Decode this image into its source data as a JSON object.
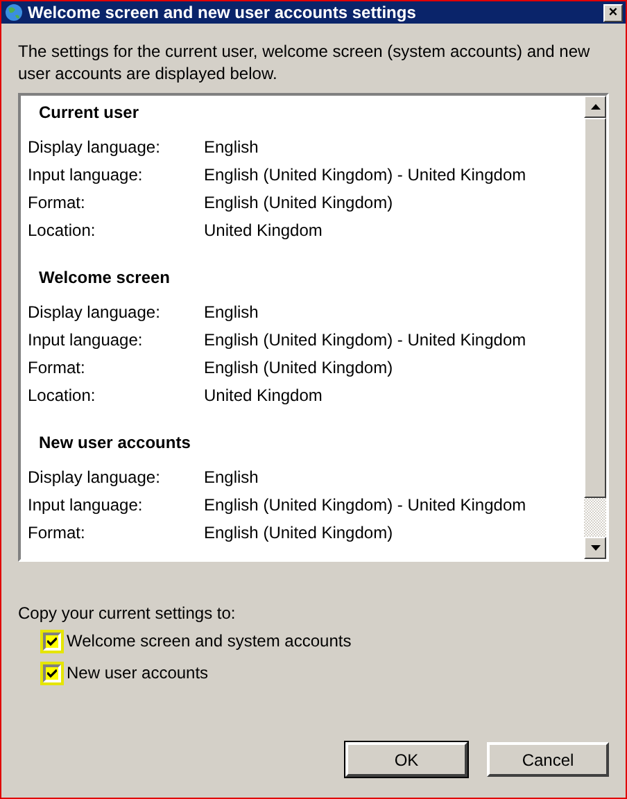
{
  "window": {
    "title": "Welcome screen and new user accounts settings",
    "close": "×"
  },
  "description": "The settings for the current user, welcome screen (system accounts) and new user accounts are displayed below.",
  "sections": [
    {
      "heading": "Current user",
      "rows": [
        {
          "label": "Display language:",
          "value": "English"
        },
        {
          "label": "Input language:",
          "value": "English (United Kingdom) - United Kingdom"
        },
        {
          "label": "Format:",
          "value": "English (United Kingdom)"
        },
        {
          "label": "Location:",
          "value": "United Kingdom"
        }
      ]
    },
    {
      "heading": "Welcome screen",
      "rows": [
        {
          "label": "Display language:",
          "value": "English"
        },
        {
          "label": "Input language:",
          "value": "English (United Kingdom) - United Kingdom"
        },
        {
          "label": "Format:",
          "value": "English (United Kingdom)"
        },
        {
          "label": "Location:",
          "value": "United Kingdom"
        }
      ]
    },
    {
      "heading": "New user accounts",
      "rows": [
        {
          "label": "Display language:",
          "value": "English"
        },
        {
          "label": "Input language:",
          "value": "English (United Kingdom) - United Kingdom"
        },
        {
          "label": "Format:",
          "value": "English (United Kingdom)"
        }
      ]
    }
  ],
  "copy_label": "Copy your current settings to:",
  "options": [
    {
      "label": "Welcome screen and system accounts",
      "checked": true,
      "highlighted": true
    },
    {
      "label": "New user accounts",
      "checked": true,
      "highlighted": true
    }
  ],
  "buttons": [
    {
      "label": "OK",
      "default": true
    },
    {
      "label": "Cancel",
      "default": false
    }
  ]
}
